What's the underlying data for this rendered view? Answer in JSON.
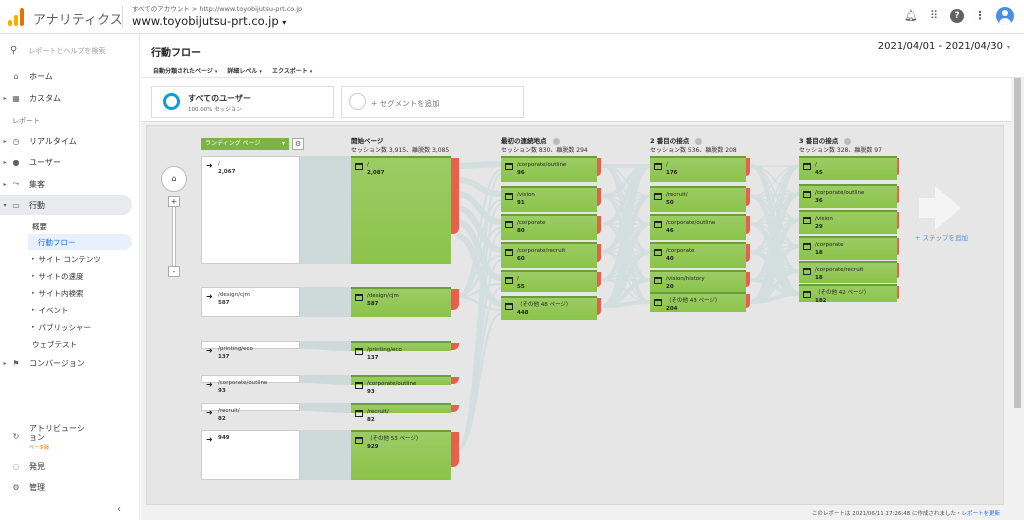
{
  "app": {
    "title": "アナリティクス",
    "breadcrumb": "すべてのアカウント > http://www.toyobijutsu-prt.co.jp",
    "account": "www.toyobijutsu-prt.co.jp",
    "account_caret": "▾"
  },
  "topbar_icons": [
    "bell-icon",
    "apps-icon",
    "help-icon",
    "more-icon",
    "avatar"
  ],
  "sidebar": {
    "search_placeholder": "レポートとヘルプを検索",
    "items_top": [
      {
        "label": "ホーム",
        "icon": "home-icon"
      },
      {
        "label": "カスタム",
        "icon": "custom-icon"
      }
    ],
    "section_reports": "レポート",
    "items_reports": [
      {
        "label": "リアルタイム",
        "icon": "clock-icon"
      },
      {
        "label": "ユーザー",
        "icon": "person-icon"
      },
      {
        "label": "集客",
        "icon": "acquisition-icon"
      },
      {
        "label": "行動",
        "icon": "behavior-icon"
      }
    ],
    "behavior_sub": [
      "概要",
      "行動フロー",
      "サイト コンテンツ",
      "サイトの速度",
      "サイト内検索",
      "イベント",
      "パブリッシャー",
      "ウェブテスト"
    ],
    "conversion": "コンバージョン",
    "bottom": [
      {
        "label": "アトリビューション",
        "badge": "ベータ版"
      },
      {
        "label": "発見"
      },
      {
        "label": "管理"
      }
    ],
    "collapse": "‹"
  },
  "header": {
    "title": "行動フロー",
    "date_range": "2021/04/01 - 2021/04/30",
    "tools": [
      "自動分類されたページ",
      "詳細レベル",
      "エクスポート"
    ]
  },
  "segments": {
    "active_name": "すべてのユーザー",
    "active_sub": "100.00% セッション",
    "add": "+ セグメントを追加"
  },
  "flow": {
    "landing_selector": "ランディング ページ",
    "columns": [
      {
        "title": "開始ページ",
        "sub": "セッション数 3,915、離脱数 3,085"
      },
      {
        "title": "最初の連続地点",
        "sub": "セッション数 830、離脱数 294"
      },
      {
        "title": "2 番目の接点",
        "sub": "セッション数 536、離脱数 208"
      },
      {
        "title": "3 番目の接点",
        "sub": "セッション数 328、離脱数 97"
      }
    ],
    "landing_nodes": [
      {
        "path": "/",
        "value": "2,067"
      },
      {
        "path": "/design/cjm",
        "value": "587"
      },
      {
        "path": "/printing/eco",
        "value": "137"
      },
      {
        "path": "/corporate/outline",
        "value": "93"
      },
      {
        "path": "/recruit/",
        "value": "82"
      },
      {
        "path": "",
        "value": "949"
      }
    ],
    "start_nodes": [
      {
        "path": "/",
        "value": "2,087"
      },
      {
        "path": "/design/cjm",
        "value": "587"
      },
      {
        "path": "/printing/eco",
        "value": "137"
      },
      {
        "path": "/corporate/outline",
        "value": "93"
      },
      {
        "path": "/recruit/",
        "value": "82"
      },
      {
        "path": "（その他 53 ページ）",
        "value": "929"
      }
    ],
    "step1_nodes": [
      {
        "path": "/corporate/outline",
        "value": "96"
      },
      {
        "path": "/vision",
        "value": "91"
      },
      {
        "path": "/corporate",
        "value": "80"
      },
      {
        "path": "/corporate/recruit",
        "value": "60"
      },
      {
        "path": "/",
        "value": "55"
      },
      {
        "path": "（その他 48 ページ）",
        "value": "448"
      }
    ],
    "step2_nodes": [
      {
        "path": "/",
        "value": "176"
      },
      {
        "path": "/recruit/",
        "value": "50"
      },
      {
        "path": "/corporate/outline",
        "value": "46"
      },
      {
        "path": "/corporate",
        "value": "40"
      },
      {
        "path": "/vision/history",
        "value": "20"
      },
      {
        "path": "（その他 43 ページ）",
        "value": "204"
      }
    ],
    "step3_nodes": [
      {
        "path": "/",
        "value": "45"
      },
      {
        "path": "/corporate/outline",
        "value": "36"
      },
      {
        "path": "/vision",
        "value": "29"
      },
      {
        "path": "/corporate",
        "value": "18"
      },
      {
        "path": "/corporate/recruit",
        "value": "18"
      },
      {
        "path": "（その他 42 ページ）",
        "value": "182"
      }
    ],
    "add_step": "+ ステップを追加",
    "colors": {
      "node": "#8bc34a",
      "exit": "#e8604c",
      "link": "#c9d6d6"
    }
  },
  "footer": {
    "text": "このレポートは 2021/06/11 17:26:48 に作成されました・",
    "link": "レポートを更新"
  }
}
